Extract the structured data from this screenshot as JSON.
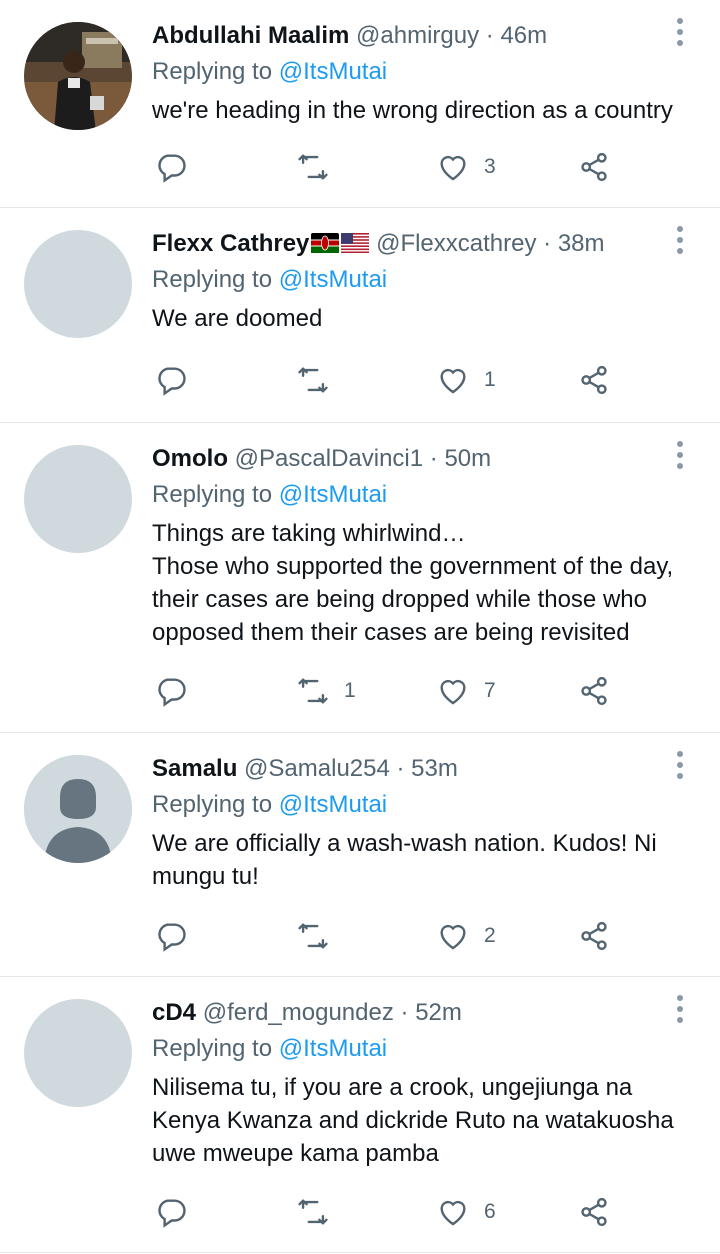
{
  "replying_prefix": "Replying to",
  "colors": {
    "accent": "#1d9bf0",
    "secondary_text": "#536471",
    "avatar_placeholder": "#cfd9de"
  },
  "tweets": [
    {
      "name": "Abdullahi Maalim",
      "handle": "@ahmirguy",
      "dot": "·",
      "time": "46m",
      "mention": "@ItsMutai",
      "lines": [
        "we're heading in the wrong direction as a country"
      ],
      "retweets": "",
      "likes": "3",
      "avatar": "photo"
    },
    {
      "name": "Flexx Cathrey",
      "flags": [
        "kenya-flag-icon",
        "us-flag-icon"
      ],
      "handle": "@Flexxcathrey",
      "dot": "·",
      "time": "38m",
      "mention": "@ItsMutai",
      "lines": [
        "We are doomed"
      ],
      "retweets": "",
      "likes": "1",
      "avatar": "blank"
    },
    {
      "name": "Omolo",
      "handle": "@PascalDavinci1",
      "dot": "·",
      "time": "50m",
      "mention": "@ItsMutai",
      "lines": [
        "Things are taking whirlwind…",
        "Those who supported the government of the day,",
        "their cases are being dropped while those who",
        "opposed them their cases are being revisited"
      ],
      "retweets": "1",
      "likes": "7",
      "avatar": "blank"
    },
    {
      "name": "Samalu",
      "handle": "@Samalu254",
      "dot": "·",
      "time": "53m",
      "mention": "@ItsMutai",
      "lines": [
        "We are officially a wash-wash nation. Kudos! Ni",
        "mungu tu!"
      ],
      "retweets": "",
      "likes": "2",
      "avatar": "default-person"
    },
    {
      "name": "cD4",
      "handle": "@ferd_mogundez",
      "dot": "·",
      "time": "52m",
      "mention": "@ItsMutai",
      "lines": [
        "Nilisema tu, if you are a crook, ungejiunga na",
        "Kenya Kwanza and dickride Ruto na watakuosha",
        "uwe mweupe kama pamba"
      ],
      "retweets": "",
      "likes": "6",
      "avatar": "blank"
    }
  ]
}
